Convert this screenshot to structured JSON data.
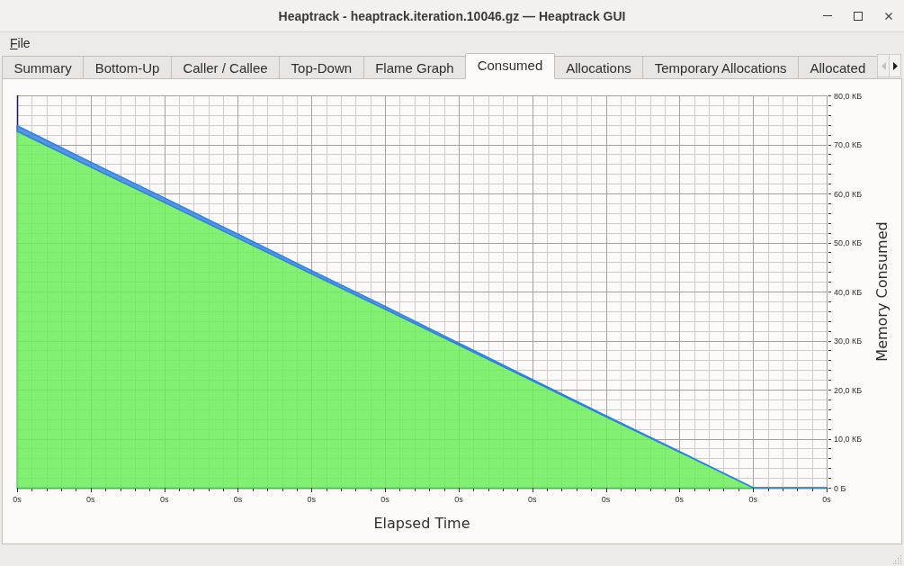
{
  "window": {
    "title": "Heaptrack - heaptrack.iteration.10046.gz — Heaptrack GUI"
  },
  "menu": [
    {
      "label": "File"
    }
  ],
  "tabs": [
    {
      "label": "Summary",
      "selected": false
    },
    {
      "label": "Bottom-Up",
      "selected": false
    },
    {
      "label": "Caller / Callee",
      "selected": false
    },
    {
      "label": "Top-Down",
      "selected": false
    },
    {
      "label": "Flame Graph",
      "selected": false
    },
    {
      "label": "Consumed",
      "selected": true
    },
    {
      "label": "Allocations",
      "selected": false
    },
    {
      "label": "Temporary Allocations",
      "selected": false
    },
    {
      "label": "Allocated",
      "selected": false
    }
  ],
  "tab_scroll": [
    {
      "kind": "left",
      "disabled": true
    },
    {
      "kind": "right",
      "disabled": false
    }
  ],
  "consumed_chart": {
    "chart_data": {
      "type": "area",
      "xlabel": "Elapsed Time",
      "ylabel": "Memory Consumed",
      "categories": [
        "0s",
        "0s",
        "0s",
        "0s",
        "0s",
        "0s",
        "0s",
        "0s",
        "0s",
        "0s",
        "0s",
        "0s"
      ],
      "series": [
        {
          "color": "#66ee55",
          "values": [
            72.7,
            65.4,
            58.2,
            50.9,
            43.6,
            36.4,
            29.1,
            21.8,
            14.5,
            7.3,
            0,
            0
          ]
        },
        {
          "color": "#2f80e0",
          "values": [
            1.1,
            1.0,
            0.9,
            0.8,
            0.7,
            0.6,
            0.4,
            0.3,
            0.2,
            0.1,
            0,
            0
          ]
        }
      ],
      "stacked": true,
      "grid": true,
      "ylim": [
        0,
        80
      ],
      "yticks": [
        {
          "value": 0,
          "label": "0 Б"
        },
        {
          "value": 10,
          "label": "10,0 КБ"
        },
        {
          "value": 20,
          "label": "20,0 КБ"
        },
        {
          "value": 30,
          "label": "30,0 КБ"
        },
        {
          "value": 40,
          "label": "40,0 КБ"
        },
        {
          "value": 50,
          "label": "50,0 КБ"
        },
        {
          "value": 60,
          "label": "60,0 КБ"
        },
        {
          "value": 70,
          "label": "70,0 КБ"
        },
        {
          "value": 80,
          "label": "80,0 КБ"
        }
      ]
    }
  }
}
